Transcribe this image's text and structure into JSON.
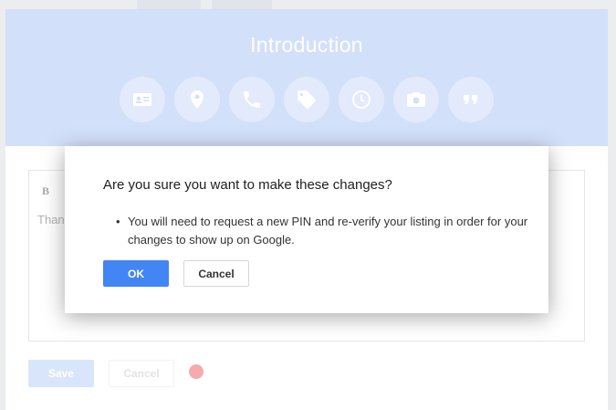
{
  "header": {
    "title": "Introduction",
    "icons": [
      "contact-card-icon",
      "location-pin-icon",
      "phone-icon",
      "tag-icon",
      "clock-icon",
      "camera-icon",
      "quote-icon"
    ]
  },
  "editor": {
    "bold_label": "B",
    "text_preview": "Than"
  },
  "form": {
    "save_label": "Save",
    "cancel_label": "Cancel"
  },
  "dialog": {
    "title": "Are you sure you want to make these changes?",
    "bullet": "You will need to request a new PIN and re-verify your listing in order for your changes to show up on Google.",
    "ok_label": "OK",
    "cancel_label": "Cancel"
  },
  "colors": {
    "header_bg": "#cddcfa",
    "primary": "#4285f4",
    "save_disabled": "#d4e2fb",
    "alert_dot": "#f4a0a0"
  }
}
